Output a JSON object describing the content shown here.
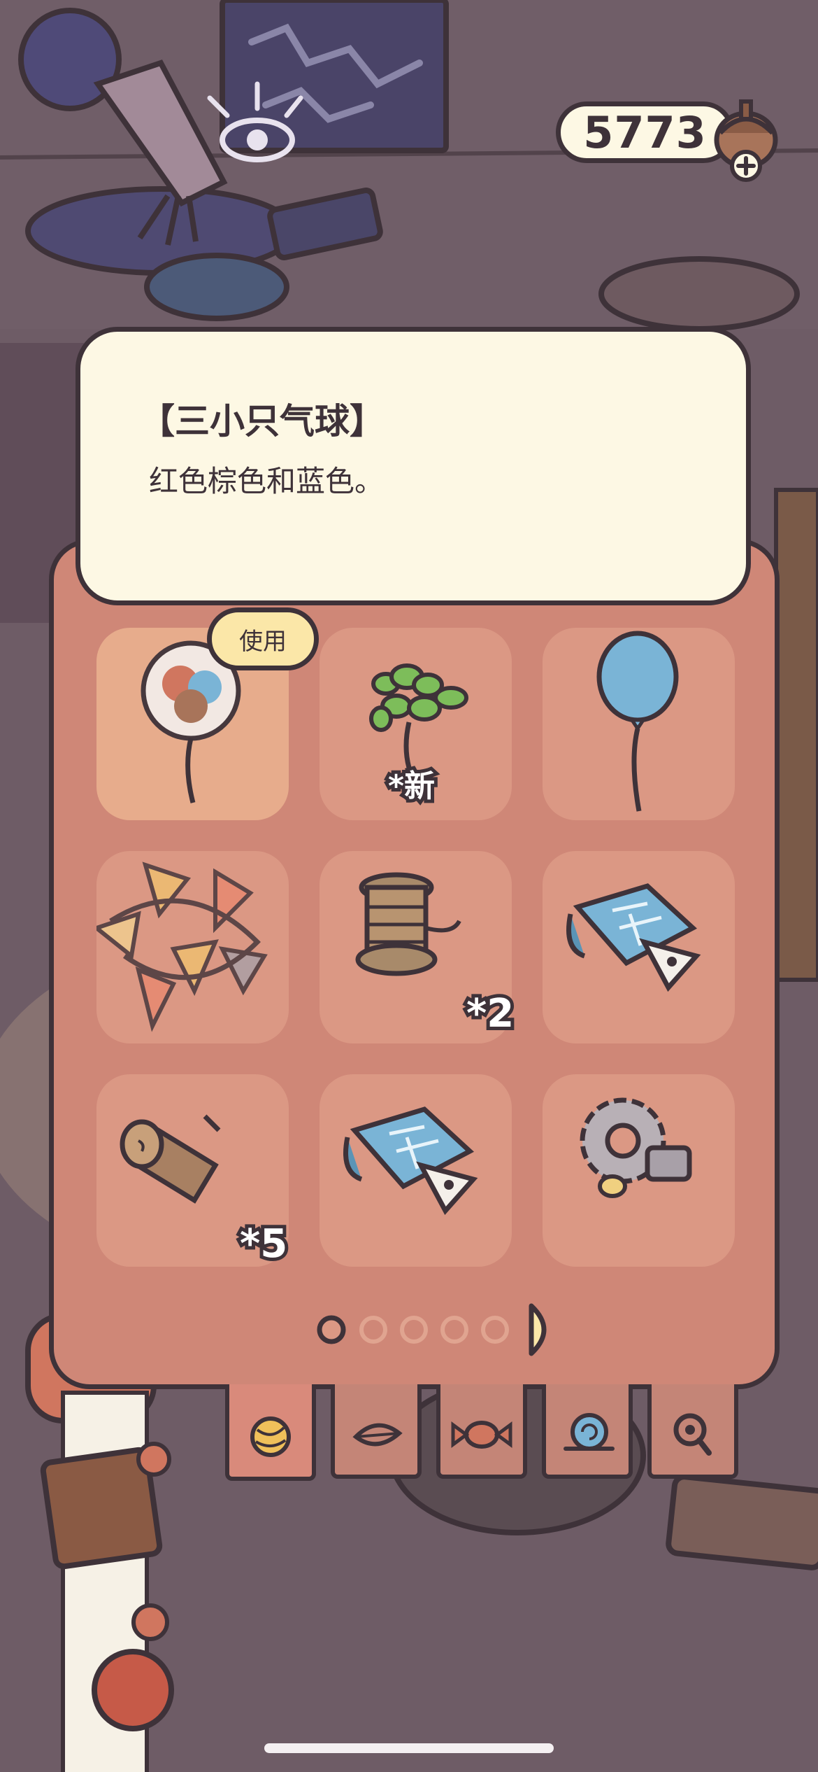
{
  "currency": {
    "amount": "5773",
    "icon": "acorn-icon",
    "add_icon": "plus-icon"
  },
  "tooltip": {
    "title": "【三小只气球】",
    "description": "红色棕色和蓝色。"
  },
  "inventory": {
    "use_label": "使用",
    "items": [
      {
        "name": "three-balloons",
        "icon": "three-balloons-icon",
        "selected": true,
        "count_label": ""
      },
      {
        "name": "balloon-dog",
        "icon": "balloon-dog-icon",
        "count_label": "*新"
      },
      {
        "name": "blue-balloon",
        "icon": "blue-balloon-icon",
        "count_label": ""
      },
      {
        "name": "bunting-flags",
        "icon": "bunting-flags-icon",
        "count_label": ""
      },
      {
        "name": "twine-spool",
        "icon": "twine-spool-icon",
        "count_label": "*2"
      },
      {
        "name": "blueprint",
        "icon": "blueprint-icon",
        "count_label": ""
      },
      {
        "name": "wood-log",
        "icon": "wood-log-icon",
        "count_label": "*5"
      },
      {
        "name": "blueprint",
        "icon": "blueprint-icon",
        "count_label": ""
      },
      {
        "name": "gears",
        "icon": "gears-icon",
        "count_label": ""
      }
    ]
  },
  "pagination": {
    "pages": 5,
    "current": 1,
    "next_icon": "next-page-icon"
  },
  "tabs": [
    {
      "name": "tab-yarn",
      "icon": "yarn-ball-icon",
      "active": true
    },
    {
      "name": "tab-leaf",
      "icon": "leaf-icon",
      "active": false
    },
    {
      "name": "tab-candy",
      "icon": "candy-icon",
      "active": false
    },
    {
      "name": "tab-snail",
      "icon": "snail-icon",
      "active": false
    },
    {
      "name": "tab-magnifier",
      "icon": "magnifier-icon",
      "active": false
    }
  ],
  "colors": {
    "panel": "#cf8777",
    "slot": "#db9884",
    "outline": "#3e3239",
    "tooltip_bg": "#fdf8e4",
    "badge": "#fbe7a8"
  }
}
